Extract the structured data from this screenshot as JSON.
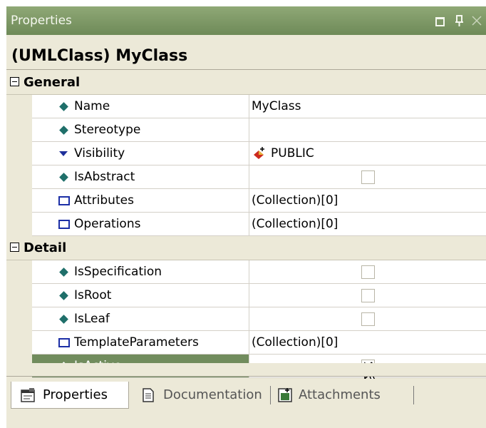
{
  "window": {
    "title": "Properties"
  },
  "header": {
    "title": "(UMLClass) MyClass"
  },
  "categories": [
    {
      "label": "General",
      "rows": [
        {
          "name": "Name",
          "icon": "diamond-icon",
          "value": "MyClass"
        },
        {
          "name": "Stereotype",
          "icon": "diamond-icon",
          "value": ""
        },
        {
          "name": "Visibility",
          "icon": "triangle-down-icon",
          "value": "PUBLIC"
        },
        {
          "name": "IsAbstract",
          "icon": "diamond-icon",
          "checked": false
        },
        {
          "name": "Attributes",
          "icon": "collection-icon",
          "value": "(Collection)[0]"
        },
        {
          "name": "Operations",
          "icon": "collection-icon",
          "value": "(Collection)[0]"
        }
      ]
    },
    {
      "label": "Detail",
      "rows": [
        {
          "name": "IsSpecification",
          "icon": "diamond-icon",
          "checked": false
        },
        {
          "name": "IsRoot",
          "icon": "diamond-icon",
          "checked": false
        },
        {
          "name": "IsLeaf",
          "icon": "diamond-icon",
          "checked": false
        },
        {
          "name": "TemplateParameters",
          "icon": "collection-icon",
          "value": "(Collection)[0]"
        },
        {
          "name": "IsActive",
          "icon": "diamond-icon",
          "checked": true,
          "selected": true
        }
      ]
    }
  ],
  "tabs": [
    {
      "label": "Properties",
      "icon": "properties-icon",
      "active": true
    },
    {
      "label": "Documentation",
      "icon": "document-icon",
      "active": false
    },
    {
      "label": "Attachments",
      "icon": "attachments-icon",
      "active": false
    }
  ],
  "colors": {
    "titlebar": "#7a9464",
    "selection": "#718c5d",
    "panel": "#ece9d8"
  }
}
